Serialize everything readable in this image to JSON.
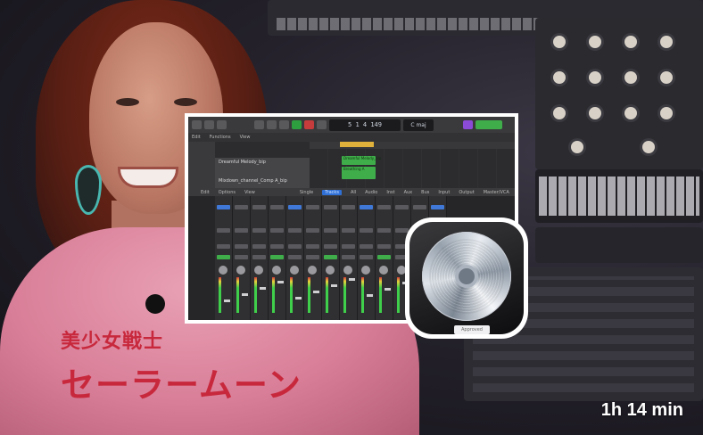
{
  "video": {
    "duration_label": "1h 14 min"
  },
  "daw_window": {
    "lcd_position": "5  1  4  149",
    "lcd_mode": "C maj",
    "menu_items": [
      "Edit",
      "Functions",
      "View"
    ],
    "tracks": [
      {
        "name": "Dreamful Melody_bip"
      },
      {
        "name": "Mixdown_channel_Comp A_bip"
      }
    ],
    "regions": [
      {
        "label": "Dreamful Melody_bip"
      },
      {
        "label": "Breathing A"
      }
    ],
    "mixer_bar": {
      "items": [
        "Edit",
        "Options",
        "View",
        "Single",
        "Tracks",
        "All",
        "Audio",
        "Inst",
        "Aux",
        "Bus",
        "Input",
        "Output",
        "Master/VCA"
      ],
      "active_item": "Tracks"
    }
  },
  "app_icon": {
    "name": "logic-pro-icon",
    "badge": "Approved"
  },
  "shirt_print": {
    "line1": "美少女戦士",
    "line2": "セーラームーン"
  },
  "colors": {
    "shirt": "#d97e98",
    "print": "#c8283c",
    "region_green": "#3fae4a",
    "cycle_yellow": "#e0b23c",
    "mixer_blue": "#3f78d6"
  }
}
